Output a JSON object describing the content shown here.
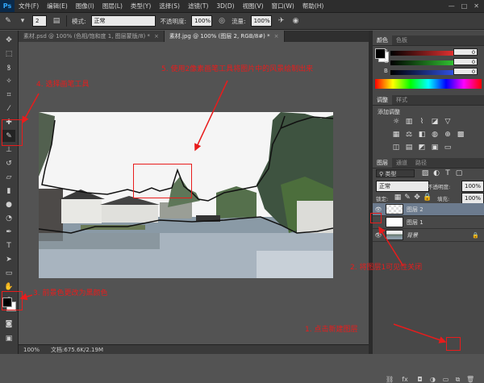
{
  "app": {
    "logo": "Ps"
  },
  "menu": [
    "文件(F)",
    "编辑(E)",
    "图像(I)",
    "图层(L)",
    "类型(Y)",
    "选择(S)",
    "滤镜(T)",
    "3D(D)",
    "视图(V)",
    "窗口(W)",
    "帮助(H)"
  ],
  "window_buttons": [
    "—",
    "□",
    "✕"
  ],
  "options": {
    "brush_size": "2",
    "mode_label": "模式:",
    "mode_value": "正常",
    "opacity_label": "不透明度:",
    "opacity_value": "100%",
    "flow_label": "流量:",
    "flow_value": "100%"
  },
  "tabs": [
    {
      "label": "素材.psd @ 100% (色相/饱和度 1, 图层蒙版/8) *",
      "close": "×"
    },
    {
      "label": "素材.jpg @ 100% (图层 2, RGB/8#) *",
      "close": "×"
    }
  ],
  "status": {
    "zoom": "100%",
    "doc": "文档:675.6K/2.19M"
  },
  "color_panel": {
    "tabs": [
      "颜色",
      "色板"
    ],
    "channels": [
      {
        "label": "R",
        "value": "0",
        "color": "#e03030"
      },
      {
        "label": "G",
        "value": "0",
        "color": "#30c030"
      },
      {
        "label": "B",
        "value": "0",
        "color": "#3050e0"
      }
    ]
  },
  "adjustments_panel": {
    "tabs": [
      "调整",
      "样式"
    ],
    "title": "添加调整"
  },
  "layers_panel": {
    "tabs": [
      "图层",
      "通道",
      "路径"
    ],
    "kind_label": "类型",
    "blend_mode": "正常",
    "opacity_label": "不透明度:",
    "opacity_value": "100%",
    "lock_label": "锁定:",
    "fill_label": "填充:",
    "fill_value": "100%",
    "layers": [
      {
        "name": "图层 2",
        "selected": true,
        "visible": true
      },
      {
        "name": "图层 1",
        "selected": false,
        "visible": false
      },
      {
        "name": "背景",
        "selected": false,
        "visible": true,
        "locked": true
      }
    ],
    "footer_icons": [
      "link-icon",
      "fx-icon",
      "mask-icon",
      "adjustment-icon",
      "folder-icon",
      "new-layer-icon",
      "trash-icon"
    ],
    "fx_label": "fx"
  },
  "annotations": {
    "step1": "1. 点击新建图层",
    "step2": "2. 将图层1可见性关闭",
    "step3": "3. 前景色更改为黑颜色",
    "step4": "4. 选择画笔工具",
    "step5": "5. 使用2像素画笔工具将图片中的风景绘制出来"
  },
  "colors": {
    "annotation": "#e81c1c",
    "selected_layer": "#6c7b8e",
    "panel_bg": "#484848"
  }
}
